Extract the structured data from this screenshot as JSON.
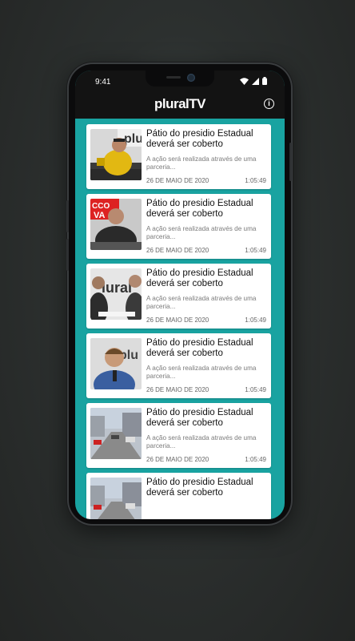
{
  "status": {
    "time": "9:41"
  },
  "app": {
    "logo_main": "plural",
    "logo_tv": "TV"
  },
  "colors": {
    "accent": "#19a3a1",
    "bar": "#131313"
  },
  "videos": [
    {
      "title": "Pátio do presidio Estadual deverá ser coberto",
      "description": "A ação será realizada através de uma parceria...",
      "date": "26 DE MAIO DE 2020",
      "duration": "1:05:49"
    },
    {
      "title": "Pátio do presidio Estadual deverá ser coberto",
      "description": "A ação será realizada através de uma parceria...",
      "date": "26 DE MAIO DE 2020",
      "duration": "1:05:49"
    },
    {
      "title": "Pátio do presidio Estadual deverá ser coberto",
      "description": "A ação será realizada através de uma parceria...",
      "date": "26 DE MAIO DE 2020",
      "duration": "1:05:49"
    },
    {
      "title": "Pátio do presidio Estadual deverá ser coberto",
      "description": "A ação será realizada através de uma parceria...",
      "date": "26 DE MAIO DE 2020",
      "duration": "1:05:49"
    },
    {
      "title": "Pátio do presidio Estadual deverá ser coberto",
      "description": "A ação será realizada através de uma parceria...",
      "date": "26 DE MAIO DE 2020",
      "duration": "1:05:49"
    },
    {
      "title": "Pátio do presidio Estadual deverá ser coberto",
      "description": "",
      "date": "",
      "duration": ""
    }
  ]
}
